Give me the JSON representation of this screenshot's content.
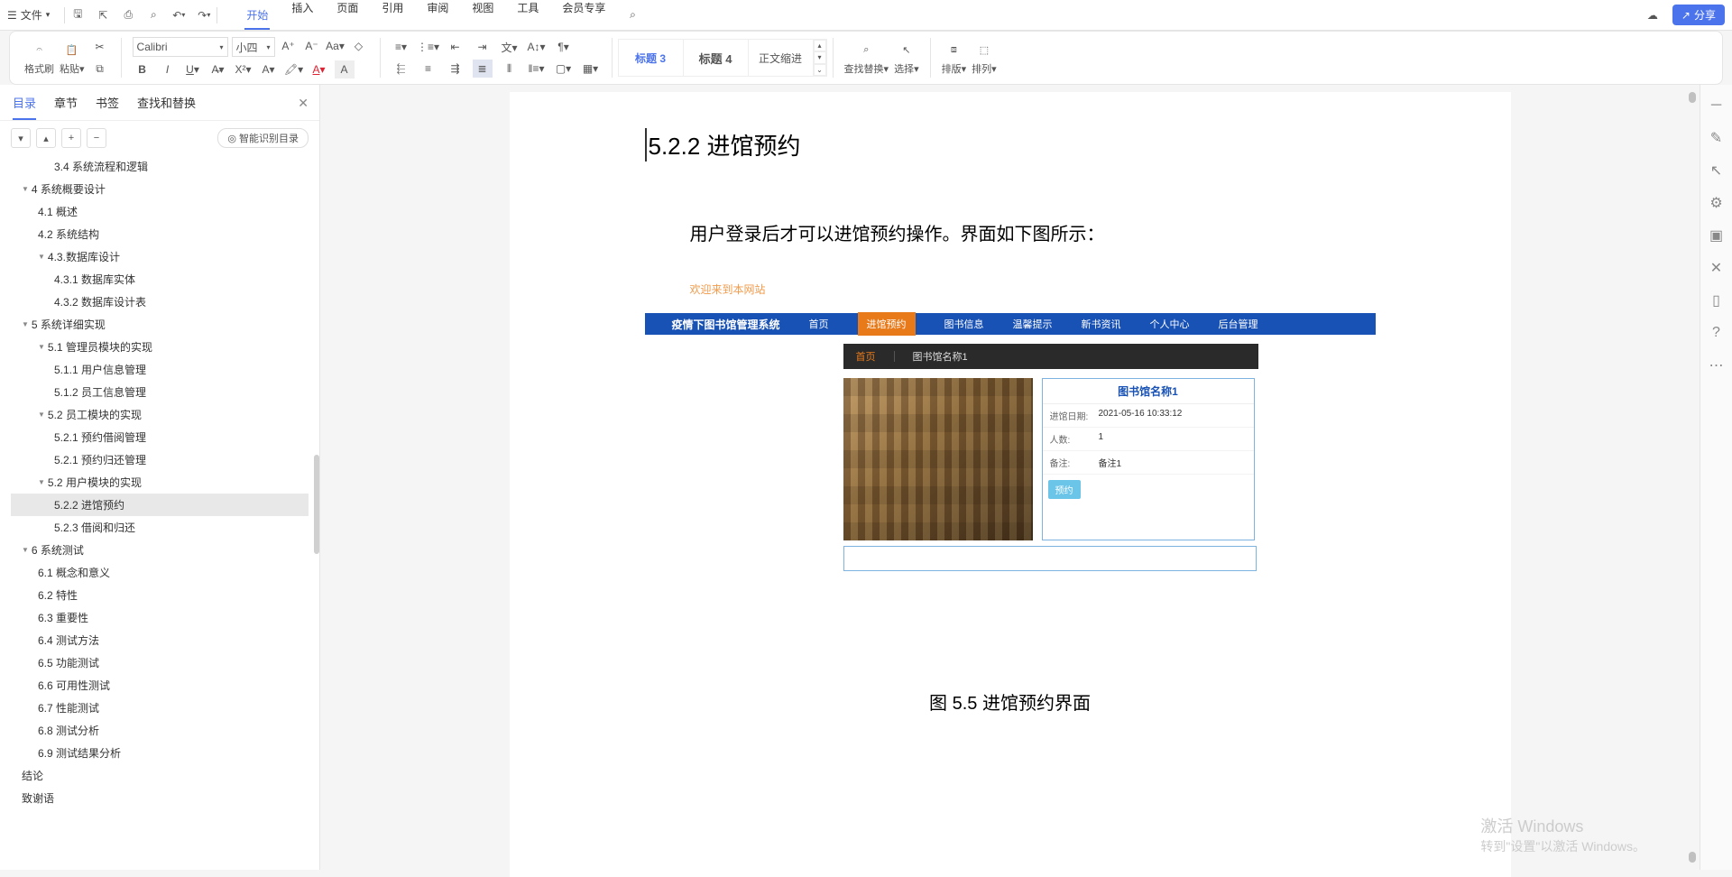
{
  "titlebar": {
    "file": "文件",
    "tabs": [
      "开始",
      "插入",
      "页面",
      "引用",
      "审阅",
      "视图",
      "工具",
      "会员专享"
    ],
    "active_tab": 0,
    "share": "分享"
  },
  "ribbon": {
    "brush": "格式刷",
    "paste": "粘贴",
    "font": "Calibri",
    "size": "小四",
    "styles": {
      "h3": "标题 3",
      "h4": "标题 4",
      "body": "正文缩进"
    },
    "find": "查找替换",
    "select": "选择",
    "layout": "排版",
    "arrange": "排列"
  },
  "sidebar": {
    "tabs": [
      "目录",
      "章节",
      "书签",
      "查找和替换"
    ],
    "active_tab": 0,
    "smart": "智能识别目录",
    "toc": [
      {
        "lv": 2,
        "txt": "3.4 系统流程和逻辑",
        "tri": ""
      },
      {
        "lv": 0,
        "txt": "4 系统概要设计",
        "tri": "▼"
      },
      {
        "lv": 1,
        "txt": "4.1 概述",
        "tri": ""
      },
      {
        "lv": 1,
        "txt": "4.2 系统结构",
        "tri": ""
      },
      {
        "lv": 1,
        "txt": "4.3.数据库设计",
        "tri": "▼"
      },
      {
        "lv": 2,
        "txt": "4.3.1 数据库实体",
        "tri": ""
      },
      {
        "lv": 2,
        "txt": "4.3.2 数据库设计表",
        "tri": ""
      },
      {
        "lv": 0,
        "txt": "5 系统详细实现",
        "tri": "▼"
      },
      {
        "lv": 1,
        "txt": "5.1  管理员模块的实现",
        "tri": "▼"
      },
      {
        "lv": 2,
        "txt": "5.1.1  用户信息管理",
        "tri": ""
      },
      {
        "lv": 2,
        "txt": "5.1.2  员工信息管理",
        "tri": ""
      },
      {
        "lv": 1,
        "txt": "5.2  员工模块的实现",
        "tri": "▼"
      },
      {
        "lv": 2,
        "txt": "5.2.1  预约借阅管理",
        "tri": ""
      },
      {
        "lv": 2,
        "txt": "5.2.1  预约归还管理",
        "tri": ""
      },
      {
        "lv": 1,
        "txt": "5.2  用户模块的实现",
        "tri": "▼"
      },
      {
        "lv": 2,
        "txt": "5.2.2  进馆预约",
        "tri": "",
        "active": true
      },
      {
        "lv": 2,
        "txt": "5.2.3  借阅和归还",
        "tri": ""
      },
      {
        "lv": 0,
        "txt": "6 系统测试",
        "tri": "▼"
      },
      {
        "lv": 1,
        "txt": "6.1 概念和意义",
        "tri": ""
      },
      {
        "lv": 1,
        "txt": "6.2 特性",
        "tri": ""
      },
      {
        "lv": 1,
        "txt": "6.3 重要性",
        "tri": ""
      },
      {
        "lv": 1,
        "txt": "6.4 测试方法",
        "tri": ""
      },
      {
        "lv": 1,
        "txt": "6.5 功能测试",
        "tri": ""
      },
      {
        "lv": 1,
        "txt": "6.6 可用性测试",
        "tri": ""
      },
      {
        "lv": 1,
        "txt": "6.7 性能测试",
        "tri": ""
      },
      {
        "lv": 1,
        "txt": "6.8 测试分析",
        "tri": ""
      },
      {
        "lv": 1,
        "txt": "6.9 测试结果分析",
        "tri": ""
      },
      {
        "lv": 0,
        "txt": "结论",
        "tri": ""
      },
      {
        "lv": 0,
        "txt": "致谢语",
        "tri": ""
      }
    ]
  },
  "doc": {
    "h3_marker": "H3",
    "heading": "5.2.2  进馆预约",
    "paragraph": "用户登录后才可以进馆预约操作。界面如下图所示：",
    "caption": "图 5.5  进馆预约界面",
    "embed": {
      "welcome": "欢迎来到本网站",
      "nav_title": "疫情下图书馆管理系统",
      "nav": [
        "首页",
        "进馆预约",
        "图书信息",
        "温馨提示",
        "新书资讯",
        "个人中心",
        "后台管理"
      ],
      "nav_active": 1,
      "bc_home": "首页",
      "bc_item": "图书馆名称1",
      "info_title": "图书馆名称1",
      "rows": [
        {
          "label": "进馆日期:",
          "val": "2021-05-16 10:33:12"
        },
        {
          "label": "人数:",
          "val": "1"
        },
        {
          "label": "备注:",
          "val": "备注1"
        }
      ],
      "reserve": "预约"
    }
  },
  "watermark": {
    "w1": "激活 Windows",
    "w2": "转到\"设置\"以激活 Windows。"
  }
}
